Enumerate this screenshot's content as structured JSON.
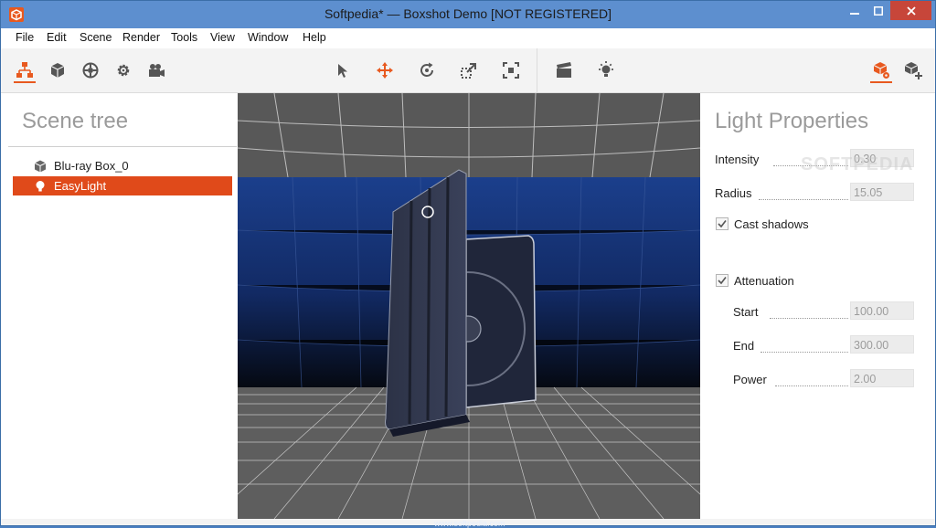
{
  "window": {
    "title": "Softpedia* — Boxshot Demo [NOT REGISTERED]",
    "accent": "#e8591f"
  },
  "menu": [
    "File",
    "Edit",
    "Scene",
    "Render",
    "Tools",
    "View",
    "Window",
    "Help"
  ],
  "toolbar": {
    "left": [
      "scene-tree-icon",
      "box-object-icon",
      "materials-icon",
      "settings-gear-icon",
      "camera-icon"
    ],
    "center": [
      "select-arrow-icon",
      "move-icon",
      "rotate-icon",
      "scale-icon",
      "fit-view-icon"
    ],
    "render": [
      "clapperboard-icon",
      "light-bulb-icon"
    ],
    "right": [
      "scene-settings-icon",
      "add-object-icon"
    ]
  },
  "scene_tree": {
    "title": "Scene tree",
    "items": [
      {
        "label": "Blu-ray Box_0",
        "icon": "box-object-icon"
      },
      {
        "label": "EasyLight",
        "icon": "light-bulb-icon",
        "selected": true
      }
    ]
  },
  "properties": {
    "title": "Light Properties",
    "intensity": {
      "label": "Intensity",
      "value": "0.30"
    },
    "radius": {
      "label": "Radius",
      "value": "15.05"
    },
    "cast_shadows": {
      "label": "Cast shadows",
      "checked": true
    },
    "attenuation": {
      "label": "Attenuation",
      "checked": true
    },
    "start": {
      "label": "Start",
      "value": "100.00"
    },
    "end": {
      "label": "End",
      "value": "300.00"
    },
    "power": {
      "label": "Power",
      "value": "2.00"
    }
  },
  "watermark": "SOFTPEDIA",
  "footer_mark": "www.softpedia.com"
}
